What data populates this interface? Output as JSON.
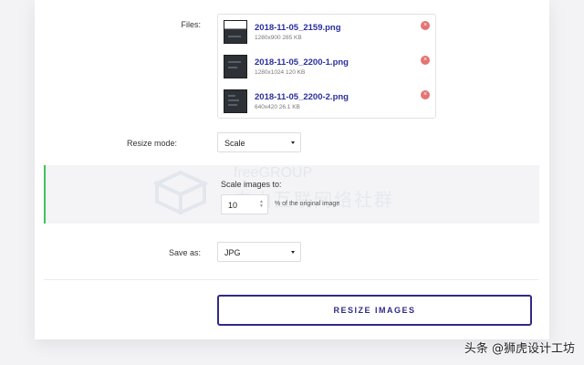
{
  "form": {
    "files_label": "Files:",
    "files": [
      {
        "name": "2018-11-05_2159.png",
        "meta": "1280x900 285 KB",
        "thumb": "light"
      },
      {
        "name": "2018-11-05_2200-1.png",
        "meta": "1280x1024 120 KB",
        "thumb": "dark"
      },
      {
        "name": "2018-11-05_2200-2.png",
        "meta": "640x420 26.1 KB",
        "thumb": "dark"
      }
    ],
    "remove_icon": "×",
    "resize_mode_label": "Resize mode:",
    "resize_mode_value": "Scale",
    "scale_title": "Scale images to:",
    "scale_value": "10",
    "scale_suffix": "% of the original image",
    "save_as_label": "Save as:",
    "save_as_value": "JPG",
    "resize_button": "RESIZE IMAGES"
  },
  "watermark": {
    "line1": "freeGROUP",
    "line2": "自由互联网络社群"
  },
  "credit": "头条 @狮虎设计工坊",
  "colors": {
    "accent": "#2f2a86",
    "link": "#2a2f9e",
    "remove": "#e57373",
    "panel_border": "#3cc45a"
  }
}
